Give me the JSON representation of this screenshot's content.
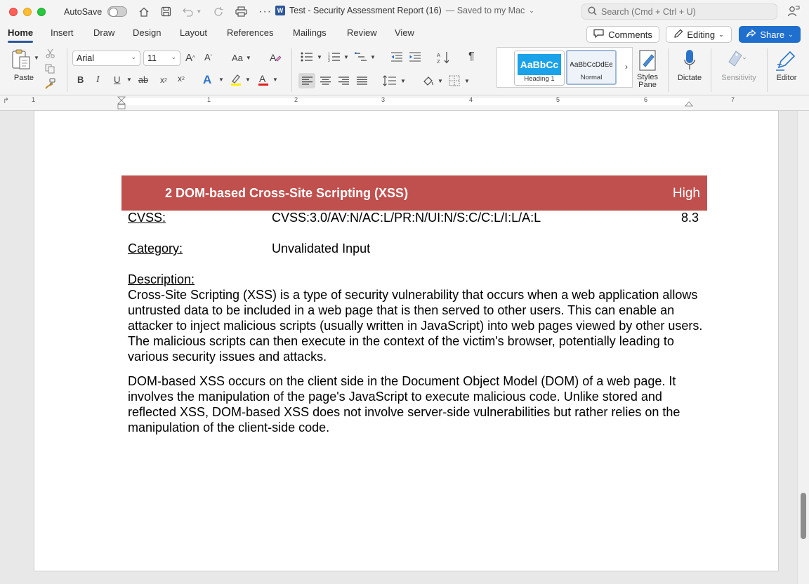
{
  "titlebar": {
    "autosave_label": "AutoSave",
    "doc_title": "Test - Security Assessment Report (16)",
    "saved_status": "— Saved to my Mac",
    "search_placeholder": "Search (Cmd + Ctrl + U)"
  },
  "tabs": [
    "Home",
    "Insert",
    "Draw",
    "Design",
    "Layout",
    "References",
    "Mailings",
    "Review",
    "View"
  ],
  "active_tab": "Home",
  "actions": {
    "comments": "Comments",
    "editing": "Editing",
    "share": "Share"
  },
  "ribbon": {
    "paste_label": "Paste",
    "font_name": "Arial",
    "font_size": "11",
    "styles": [
      {
        "preview": "AaBbCc",
        "name": "Heading 1"
      },
      {
        "preview": "AaBbCcDdEe",
        "name": "Normal"
      }
    ],
    "styles_pane_line1": "Styles",
    "styles_pane_line2": "Pane",
    "dictate_label": "Dictate",
    "sensitivity_label": "Sensitivity",
    "editor_label": "Editor",
    "bold": "B",
    "italic": "I",
    "underline": "U",
    "strike": "ab",
    "pilcrow": "¶"
  },
  "ruler_numbers": [
    "1",
    "1",
    "2",
    "3",
    "4",
    "5",
    "6",
    "7"
  ],
  "document": {
    "heading_title": "2 DOM-based Cross-Site Scripting (XSS)",
    "heading_severity": "High",
    "cvss_label": "CVSS:",
    "cvss_vector": "CVSS:3.0/AV:N/AC:L/PR:N/UI:N/S:C/C:L/I:L/A:L",
    "cvss_score": "8.3",
    "category_label": "Category:",
    "category_value": "Unvalidated Input",
    "description_label": "Description:",
    "description_p1": "Cross-Site Scripting (XSS) is a type of security vulnerability that occurs when a web application allows untrusted data to be included in a web page that is then served to other users. This can enable an attacker to inject malicious scripts (usually written in JavaScript) into web pages viewed by other users. The malicious scripts can then execute in the context of the victim's browser, potentially leading to various security issues and attacks.",
    "description_p2": "DOM-based XSS occurs on the client side in the Document Object Model (DOM) of a web page. It involves the manipulation of the page's JavaScript to execute malicious code. Unlike stored and reflected XSS, DOM-based XSS does not involve server-side vulnerabilities but rather relies on the manipulation of the client-side code."
  },
  "colors": {
    "heading_bar": "#c0504d",
    "share_button": "#1f6fce",
    "tab_underline": "#2b579a",
    "heading1_style": "#1aa3e8"
  }
}
